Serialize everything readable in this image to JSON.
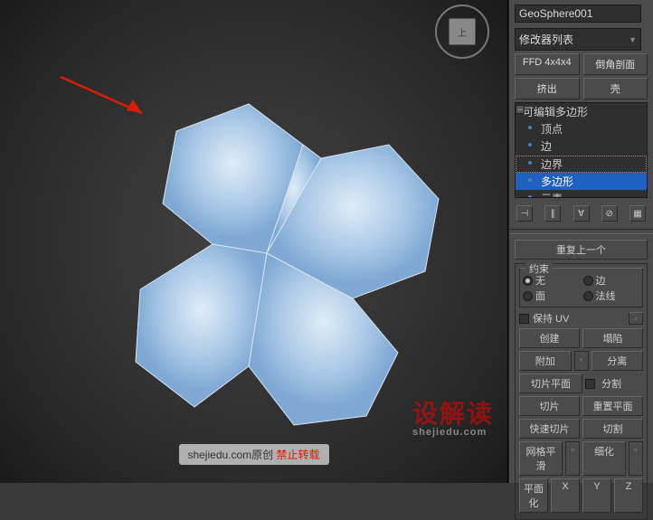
{
  "viewport": {
    "nav_cube_label": "上",
    "watermark_big": "设解读",
    "watermark_url": "shejiedu.com",
    "watermark_footer": "shejiedu.com原创",
    "watermark_forbid": "禁止转载"
  },
  "panel": {
    "object_name": "GeoSphere001",
    "modifier_list_label": "修改器列表",
    "btn_ffd": "FFD 4x4x4",
    "btn_chamfer": "倒角剖面",
    "btn_extrude": "挤出",
    "btn_shell": "壳",
    "stack": {
      "root": "可编辑多边形",
      "subs": [
        "顶点",
        "边",
        "边界",
        "多边形",
        "元素"
      ],
      "selected_index": 3
    },
    "rollout_repeat": "重复上一个",
    "constraint": {
      "title": "约束",
      "none": "无",
      "edge": "边",
      "face": "面",
      "normal": "法线"
    },
    "preserve_uv": "保持 UV",
    "actions": {
      "create": "创建",
      "collapse": "塌陷",
      "attach": "附加",
      "detach": "分离",
      "slice_plane": "切片平面",
      "split": "分割",
      "slice": "切片",
      "reset_plane": "重置平面",
      "quickslice": "快速切片",
      "cut": "切割",
      "msmooth": "网格平滑",
      "tessellate": "细化",
      "planarize": "平面化",
      "x": "X",
      "y": "Y",
      "z": "Z"
    }
  }
}
